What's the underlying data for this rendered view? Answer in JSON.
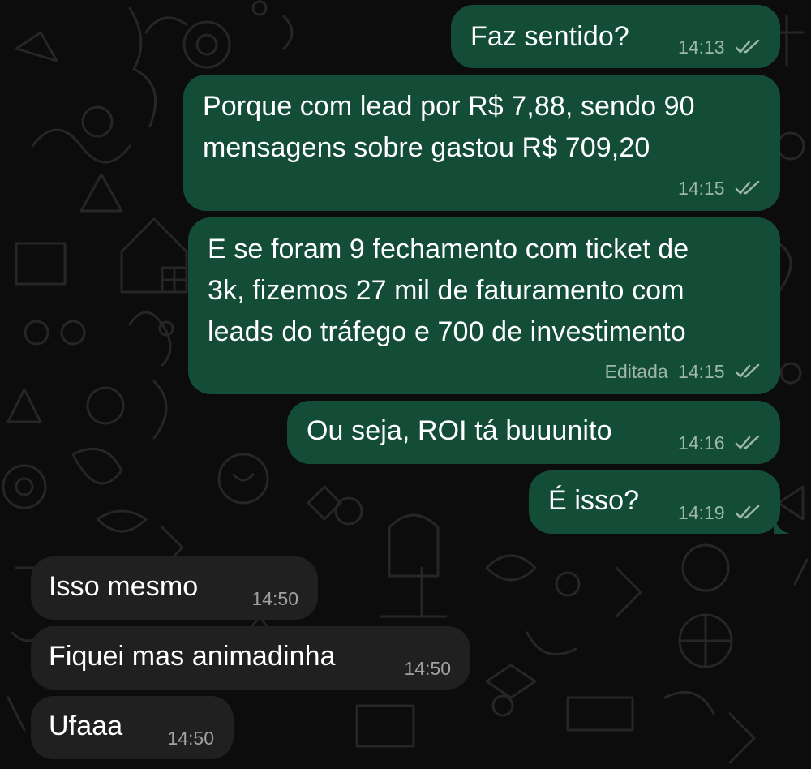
{
  "conversation": {
    "messages": [
      {
        "text": "Faz sentido?",
        "time": "14:13",
        "status_icon": "double-check-icon"
      },
      {
        "lines": [
          "Porque com lead por R$ 7,88, sendo 90",
          "mensagens sobre gastou R$ 709,20"
        ],
        "time": "14:15",
        "status_icon": "double-check-icon"
      },
      {
        "lines": [
          "E se foram 9 fechamento com ticket de",
          "3k, fizemos 27 mil de faturamento com",
          "leads do tráfego e 700 de investimento"
        ],
        "edited": "Editada",
        "time": "14:15",
        "status_icon": "double-check-icon"
      },
      {
        "text": "Ou seja, ROI tá buuunito",
        "time": "14:16",
        "status_icon": "double-check-icon"
      },
      {
        "text": "É isso?",
        "time": "14:19",
        "status_icon": "double-check-icon"
      },
      {
        "text": "Isso mesmo",
        "time": "14:50"
      },
      {
        "text": "Fiquei mas animadinha",
        "time": "14:50"
      },
      {
        "text": "Ufaaa",
        "time": "14:50"
      }
    ]
  },
  "colors": {
    "background": "#0c0c0c",
    "outgoing_bubble": "#134d37",
    "incoming_bubble": "#202020",
    "outgoing_meta": "#9fb7aa",
    "incoming_meta": "#a1a1a1",
    "read_ticks": "#9fb7aa"
  }
}
